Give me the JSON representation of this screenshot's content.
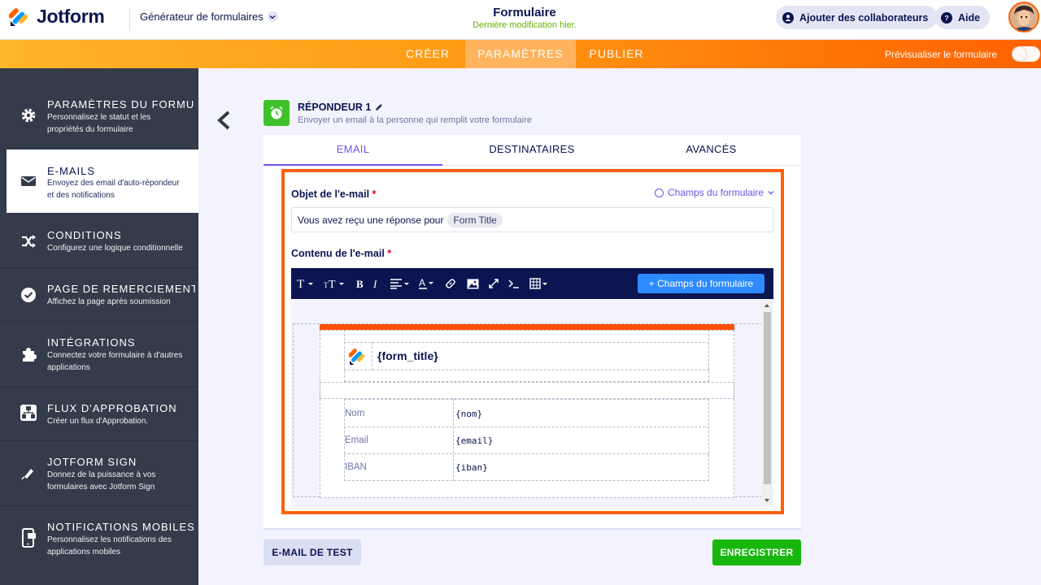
{
  "header": {
    "brand": "Jotform",
    "builder_label": "Générateur de formulaires",
    "form_title": "Formulaire",
    "last_modified": "Dernière modification hier.",
    "collaborators_label": "Ajouter des collaborateurs",
    "help_label": "Aide"
  },
  "nav": {
    "tabs": [
      {
        "label": "CRÉER"
      },
      {
        "label": "PARAMÈTRES"
      },
      {
        "label": "PUBLIER"
      }
    ],
    "active_tab": "PARAMÈTRES",
    "preview_label": "Prévisualiser le formulaire"
  },
  "sidebar": {
    "items": [
      {
        "title": "PARAMÈTRES DU FORMU…",
        "desc": "Personnalisez le statut et les propriétés du formulaire",
        "icon": "gear-icon"
      },
      {
        "title": "E-MAILS",
        "desc": "Envoyez des email d'auto-répondeur et des notifications",
        "icon": "envelope-icon"
      },
      {
        "title": "CONDITIONS",
        "desc": "Configurez une logique conditionnelle",
        "icon": "shuffle-icon"
      },
      {
        "title": "PAGE DE REMERCIEMENTS",
        "desc": "Affichez la page après soumission",
        "icon": "check-circle-icon"
      },
      {
        "title": "INTÉGRATIONS",
        "desc": "Connectez votre formulaire à d'autres applications",
        "icon": "puzzle-icon"
      },
      {
        "title": "FLUX D'APPROBATION",
        "desc": "Créer un flux d'Approbation.",
        "icon": "flow-icon"
      },
      {
        "title": "JOTFORM SIGN",
        "desc": "Donnez de la puissance à vos formulaires avec Jotform Sign",
        "icon": "pen-icon"
      },
      {
        "title": "NOTIFICATIONS MOBILES",
        "desc": "Personnalisez les notifications des applications mobiles",
        "icon": "mobile-icon"
      }
    ],
    "active_index": 1
  },
  "responder": {
    "title": "RÉPONDEUR 1",
    "subtitle": "Envoyer un email à la personne qui remplit votre formulaire"
  },
  "panel_tabs": [
    {
      "label": "EMAIL"
    },
    {
      "label": "DESTINATAIRES"
    },
    {
      "label": "AVANCÉS"
    }
  ],
  "email": {
    "subject_label": "Objet de l'e-mail",
    "required_mark": "*",
    "form_fields_link": "Champs du formulaire",
    "subject_text": "Vous avez reçu une réponse pour",
    "subject_tag": "Form Title",
    "content_label": "Contenu de l'e-mail",
    "toolbar_field_button": "+ Champs du formulaire",
    "body_title": "{form_title}",
    "rows": [
      {
        "key": "Nom",
        "value": "{nom}"
      },
      {
        "key": "Email",
        "value": "{email}"
      },
      {
        "key": "IBAN",
        "value": "{iban}"
      }
    ]
  },
  "footer": {
    "test_button": "E-MAIL DE TEST",
    "save_button": "ENREGISTRER"
  },
  "colors": {
    "accent": "#ff6100",
    "primary_purple": "#6f54e6",
    "save_green": "#18b70d",
    "navy": "#0a1551"
  }
}
